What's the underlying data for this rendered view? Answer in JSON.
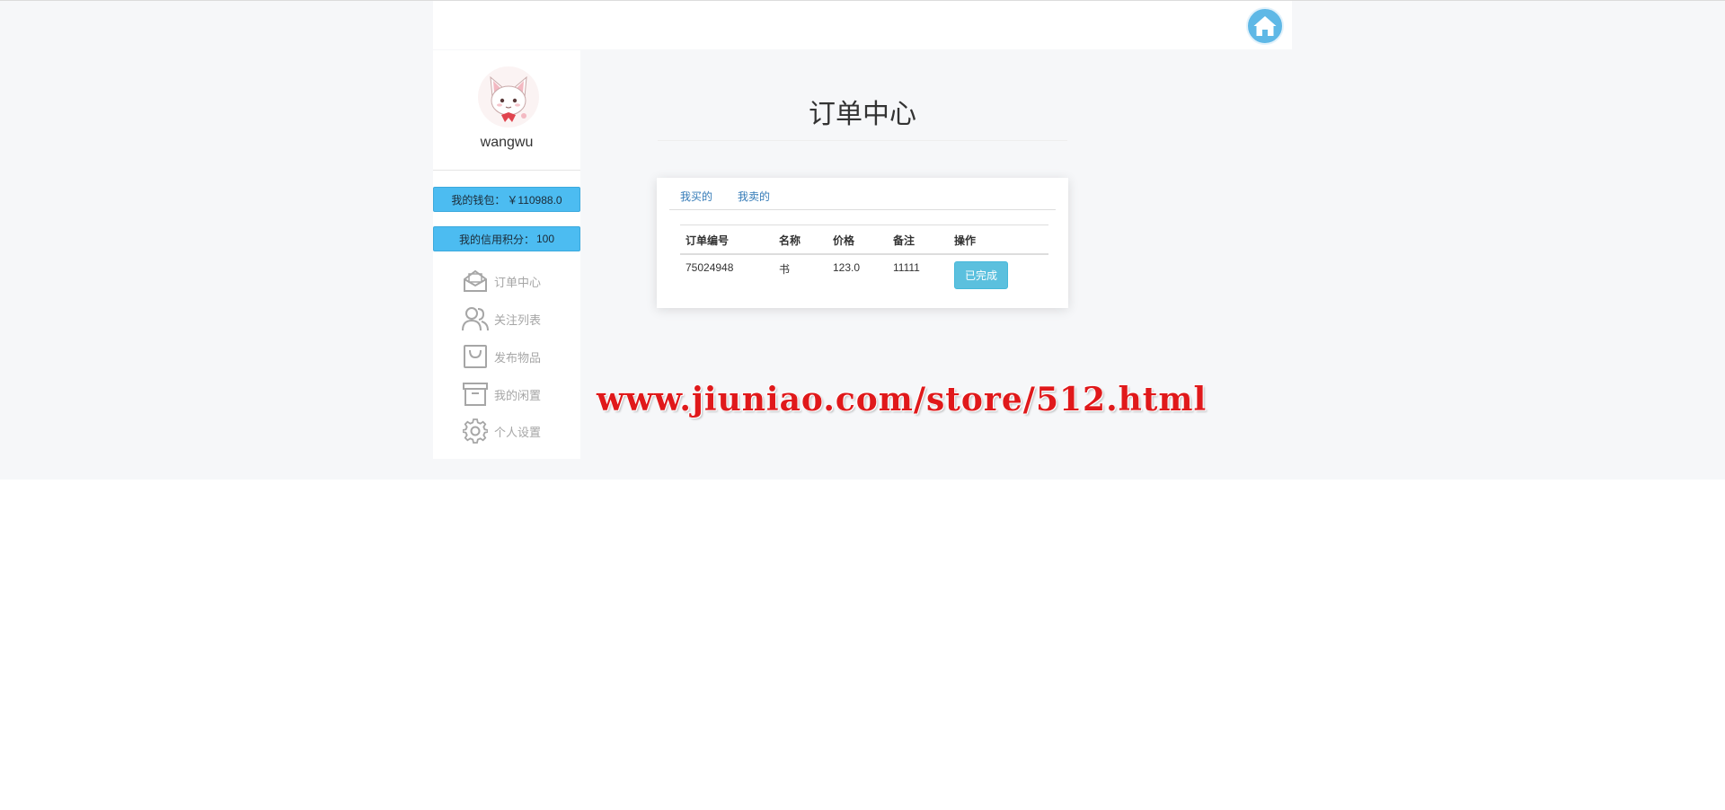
{
  "header": {
    "home_icon": "home-icon"
  },
  "user": {
    "name": "wangwu",
    "avatar_icon": "cat-avatar"
  },
  "sidebar": {
    "wallet_label": "我的钱包：",
    "wallet_value": "￥110988.0",
    "credit_label": "我的信用积分：",
    "credit_value": "100",
    "items": [
      {
        "label": "订单中心",
        "icon": "mail-open-icon"
      },
      {
        "label": "关注列表",
        "icon": "users-icon"
      },
      {
        "label": "发布物品",
        "icon": "shopping-bag-icon"
      },
      {
        "label": "我的闲置",
        "icon": "archive-box-icon"
      },
      {
        "label": "个人设置",
        "icon": "gear-icon"
      }
    ]
  },
  "main": {
    "title": "订单中心",
    "tabs": [
      {
        "label": "我买的"
      },
      {
        "label": "我卖的"
      }
    ],
    "table": {
      "columns": [
        "订单编号",
        "名称",
        "价格",
        "备注",
        "操作"
      ],
      "rows": [
        {
          "order_id": "75024948",
          "name": "书",
          "price": "123.0",
          "remark": "11111",
          "action": "已完成"
        }
      ]
    }
  },
  "watermark": "www.jiuniao.com/store/512.html",
  "colors": {
    "accent": "#4cbcf1",
    "status": "#5bc0de",
    "home": "#5fb8e6",
    "watermark": "#e0191b"
  }
}
